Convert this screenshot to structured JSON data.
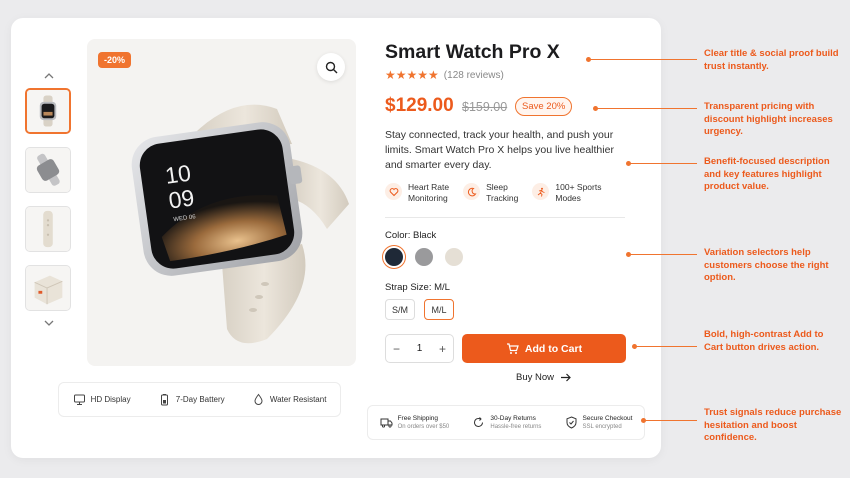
{
  "product": {
    "discount_badge": "-20%",
    "title": "Smart Watch Pro X",
    "stars": "★★★★★",
    "reviews": "(128 reviews)",
    "price": "$129.00",
    "old_price": "$159.00",
    "save_badge": "Save 20%",
    "description": "Stay connected, track your health, and push your limits. Smart Watch Pro X helps you live healthier and smarter every day.",
    "watch_time_hour": "10",
    "watch_time_min": "09",
    "watch_date": "WED 06"
  },
  "benefits": [
    {
      "icon": "heart-icon",
      "line1": "Heart Rate",
      "line2": "Monitoring"
    },
    {
      "icon": "moon-icon",
      "line1": "Sleep",
      "line2": "Tracking"
    },
    {
      "icon": "running-icon",
      "line1": "100+ Sports",
      "line2": "Modes"
    }
  ],
  "color": {
    "label": "Color: Black",
    "options": [
      {
        "name": "Black",
        "hex": "#1f2937"
      },
      {
        "name": "Gray",
        "hex": "#9a9a9c"
      },
      {
        "name": "Cream",
        "hex": "#e5dfd5"
      }
    ]
  },
  "strap": {
    "label": "Strap Size: M/L",
    "options": [
      "S/M",
      "M/L"
    ],
    "selected": "M/L"
  },
  "quantity": {
    "minus": "−",
    "value": "1",
    "plus": "+"
  },
  "actions": {
    "add_to_cart": "Add to Cart",
    "buy_now": "Buy Now"
  },
  "image_features": [
    {
      "icon": "display-icon",
      "label": "HD Display"
    },
    {
      "icon": "battery-icon",
      "label": "7-Day Battery"
    },
    {
      "icon": "water-drop-icon",
      "label": "Water Resistant"
    }
  ],
  "trust": [
    {
      "icon": "truck-icon",
      "title": "Free Shipping",
      "sub": "On orders over $50"
    },
    {
      "icon": "return-icon",
      "title": "30-Day Returns",
      "sub": "Hassle-free returns"
    },
    {
      "icon": "shield-icon",
      "title": "Secure Checkout",
      "sub": "SSL encrypted"
    }
  ],
  "annotations": [
    "Clear title & social proof build trust instantly.",
    "Transparent pricing with discount highlight increases urgency.",
    "Benefit-focused description and key features highlight product value.",
    "Variation selectors help customers choose the right option.",
    "Bold, high-contrast Add to Cart button drives action.",
    "Trust signals reduce purchase hesitation and boost confidence."
  ],
  "colors": {
    "accent": "#ec5a1c",
    "accent_light": "#f0742f",
    "background": "#ebebed"
  }
}
